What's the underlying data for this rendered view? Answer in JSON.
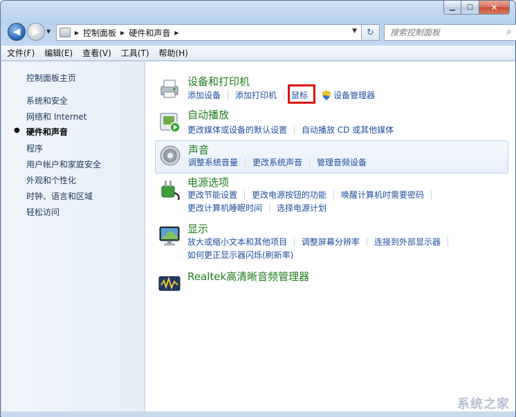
{
  "window": {
    "controls": {
      "minimize": "▁",
      "maximize": "□",
      "close": "✕"
    }
  },
  "nav": {
    "back_icon": "◀",
    "forward_icon": "▶",
    "breadcrumb": [
      "控制面板",
      "硬件和声音"
    ],
    "search_placeholder": "搜索控制面板",
    "refresh_icon": "↻",
    "search_icon": "⌕"
  },
  "menubar": {
    "items": [
      "文件(F)",
      "编辑(E)",
      "查看(V)",
      "工具(T)",
      "帮助(H)"
    ]
  },
  "sidebar": {
    "items": [
      {
        "label": "控制面板主页",
        "current": false
      },
      {
        "label": "系统和安全",
        "current": false
      },
      {
        "label": "网络和 Internet",
        "current": false
      },
      {
        "label": "硬件和声音",
        "current": true
      },
      {
        "label": "程序",
        "current": false
      },
      {
        "label": "用户帐户和家庭安全",
        "current": false
      },
      {
        "label": "外观和个性化",
        "current": false
      },
      {
        "label": "时钟、语言和区域",
        "current": false
      },
      {
        "label": "轻松访问",
        "current": false
      }
    ]
  },
  "categories": [
    {
      "title": "设备和打印机",
      "icon": "printer-icon",
      "lines": [
        [
          "添加设备",
          "添加打印机",
          "鼠标",
          "设备管理器"
        ]
      ]
    },
    {
      "title": "自动播放",
      "icon": "autoplay-icon",
      "lines": [
        [
          "更改媒体或设备的默认设置",
          "自动播放 CD 或其他媒体"
        ]
      ]
    },
    {
      "title": "声音",
      "icon": "speaker-icon",
      "lines": [
        [
          "调整系统音量",
          "更改系统声音",
          "管理音频设备"
        ]
      ]
    },
    {
      "title": "电源选项",
      "icon": "power-plug-icon",
      "lines": [
        [
          "更改节能设置",
          "更改电源按钮的功能",
          "唤醒计算机时需要密码"
        ],
        [
          "更改计算机睡眠时间",
          "选择电源计划"
        ]
      ]
    },
    {
      "title": "显示",
      "icon": "monitor-icon",
      "lines": [
        [
          "放大或缩小文本和其他项目",
          "调整屏幕分辨率",
          "连接到外部显示器"
        ],
        [
          "如何更正显示器闪烁(刷新率)"
        ]
      ]
    },
    {
      "title": "Realtek高清晰音频管理器",
      "icon": "realtek-audio-icon",
      "lines": []
    }
  ],
  "watermark": "系统之家",
  "colors": {
    "link": "#1e4fa0",
    "category_title": "#1e7e1e",
    "highlight": "#e01010"
  }
}
